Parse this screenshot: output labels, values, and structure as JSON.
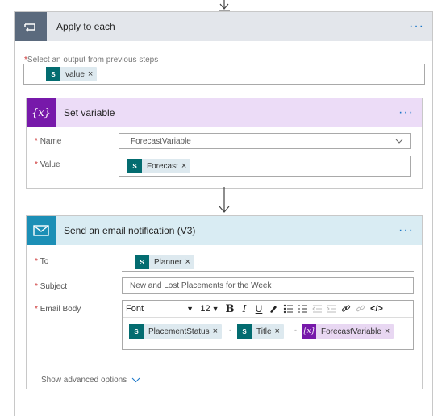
{
  "loop": {
    "title": "Apply to each",
    "output_label": "Select an output from previous steps",
    "output_token": "value"
  },
  "set_variable": {
    "title": "Set variable",
    "name_label": "Name",
    "name_value": "ForecastVariable",
    "value_label": "Value",
    "value_token": "Forecast"
  },
  "email": {
    "title": "Send an email notification (V3)",
    "to_label": "To",
    "to_token": "Planner",
    "to_suffix": ";",
    "subject_label": "Subject",
    "subject_value": "New and Lost Placements for the Week",
    "body_label": "Email Body",
    "toolbar": {
      "font": "Font",
      "size": "12",
      "bold": "B",
      "italic": "I",
      "underline": "U",
      "code": "</>"
    },
    "body_tokens": [
      "PlacementStatus",
      "Title",
      "ForecastVariable"
    ],
    "show_advanced": "Show advanced options"
  },
  "common": {
    "required_mark": "*",
    "more_menu": "···",
    "remove_mark": "×",
    "sharepoint_icon": "sharepoint-icon",
    "variable_icon": "variable-icon",
    "colors": {
      "loop_header": "#e3e6eb",
      "variable_header": "#ecdcf7",
      "variable_icon_bg": "#7719aa",
      "email_header": "#d9ecf3",
      "email_icon_bg": "#1c8fb6",
      "sharepoint_token_bg": "#036c70",
      "accent": "#1976c8"
    }
  }
}
